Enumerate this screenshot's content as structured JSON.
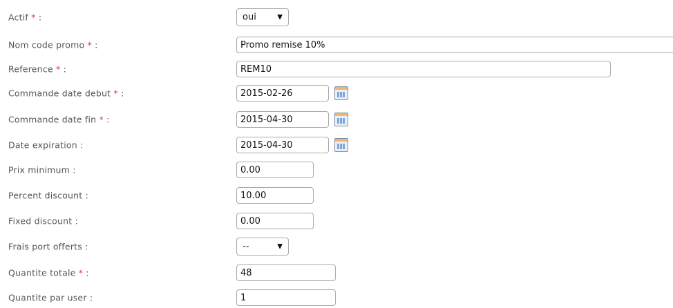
{
  "fields": {
    "actif": {
      "label": "Actif",
      "required_mark": "*",
      "colon": ":",
      "value": "oui"
    },
    "nom_code_promo": {
      "label": "Nom code promo",
      "required_mark": "*",
      "colon": ":",
      "value": "Promo remise 10%"
    },
    "reference": {
      "label": "Reference",
      "required_mark": "*",
      "colon": ":",
      "value": "REM10"
    },
    "commande_date_debut": {
      "label": "Commande date debut",
      "required_mark": "*",
      "colon": ":",
      "value": "2015-02-26"
    },
    "commande_date_fin": {
      "label": "Commande date fin",
      "required_mark": "*",
      "colon": ":",
      "value": "2015-04-30"
    },
    "date_expiration": {
      "label": "Date expiration",
      "colon": ":",
      "value": "2015-04-30"
    },
    "prix_minimum": {
      "label": "Prix minimum",
      "colon": ":",
      "value": "0.00"
    },
    "percent_discount": {
      "label": "Percent discount",
      "colon": ":",
      "value": "10.00"
    },
    "fixed_discount": {
      "label": "Fixed discount",
      "colon": ":",
      "value": "0.00"
    },
    "frais_port_offerts": {
      "label": "Frais port offerts",
      "colon": ":",
      "value": "--"
    },
    "quantite_totale": {
      "label": "Quantite totale",
      "required_mark": "*",
      "colon": ":",
      "value": "48"
    },
    "quantite_par_user": {
      "label": "Quantite par user",
      "colon": ":",
      "value": "1"
    }
  },
  "icons": {
    "calendar": "calendar-icon",
    "dropdown": "chevron-down-icon"
  },
  "colors": {
    "label": "#555555",
    "required": "#e0403a",
    "border": "#a9a9a9"
  }
}
